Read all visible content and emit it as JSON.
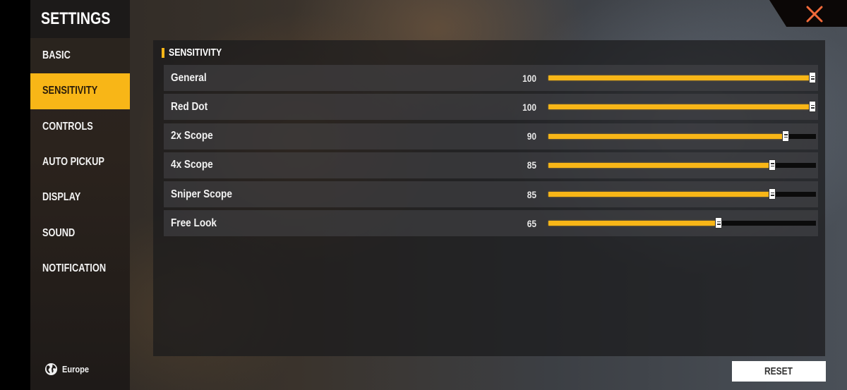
{
  "sidebar": {
    "title": "SETTINGS",
    "items": [
      {
        "label": "BASIC",
        "active": false
      },
      {
        "label": "SENSITIVITY",
        "active": true
      },
      {
        "label": "CONTROLS",
        "active": false
      },
      {
        "label": "AUTO PICKUP",
        "active": false
      },
      {
        "label": "DISPLAY",
        "active": false
      },
      {
        "label": "SOUND",
        "active": false
      },
      {
        "label": "NOTIFICATION",
        "active": false
      }
    ],
    "region": {
      "icon": "globe-icon",
      "label": "Europe"
    }
  },
  "close": {
    "icon": "close-icon",
    "color": "#f26a3a"
  },
  "panel": {
    "title": "SENSITIVITY",
    "rows": [
      {
        "label": "General",
        "value": "100",
        "percent": 100
      },
      {
        "label": "Red Dot",
        "value": "100",
        "percent": 100
      },
      {
        "label": "2x Scope",
        "value": "90",
        "percent": 90
      },
      {
        "label": "4x Scope",
        "value": "85",
        "percent": 85
      },
      {
        "label": "Sniper Scope",
        "value": "85",
        "percent": 85
      },
      {
        "label": "Free Look",
        "value": "65",
        "percent": 65
      }
    ]
  },
  "reset_label": "RESET",
  "colors": {
    "accent": "#f8b617",
    "track": "#0b0b0b"
  }
}
